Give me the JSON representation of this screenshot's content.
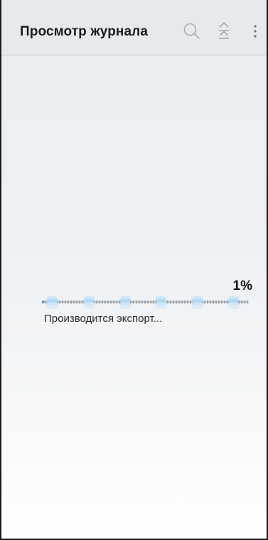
{
  "app_bar": {
    "title": "Просмотр журнала",
    "icons": {
      "search": "search-icon",
      "collapse": "collapse-all-icon",
      "more": "more-vertical-icon"
    }
  },
  "export": {
    "percent_label": "1%",
    "progress": 0.01,
    "status_text": "Производится экспорт..."
  },
  "colors": {
    "app_bar_bg": "#e6eaee",
    "accent": "#3f8fd6",
    "text": "#1c1c1c"
  }
}
